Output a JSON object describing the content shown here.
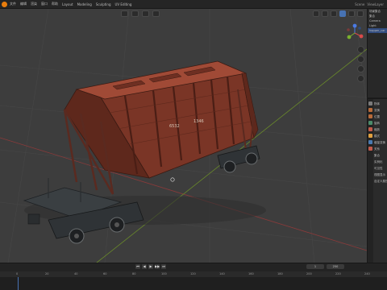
{
  "menu": {
    "items": [
      "文件",
      "编辑",
      "渲染",
      "窗口",
      "帮助",
      "Layout",
      "Modeling",
      "Sculpting",
      "UV Editing"
    ],
    "right": [
      "Scene",
      "ViewLayer"
    ]
  },
  "outliner": {
    "rows": [
      "场景集合",
      "集合",
      "Camera",
      "Light",
      "hopper_car"
    ]
  },
  "properties": {
    "rows": [
      "物体",
      "变换",
      "位置",
      "旋转",
      "缩放",
      "模式",
      "增量变换",
      "关系",
      "集合",
      "实例化",
      "可见性",
      "视图显示",
      "自定义属性"
    ]
  },
  "model": {
    "label_left": "6532",
    "label_right": "1346"
  },
  "timeline": {
    "ticks": [
      "0",
      "20",
      "40",
      "60",
      "80",
      "100",
      "120",
      "140",
      "160",
      "180",
      "200",
      "220",
      "240"
    ],
    "start_frame": "1",
    "end_frame": "250",
    "playback": [
      "⏮",
      "◀",
      "▶",
      "▶▶",
      "⏭"
    ]
  },
  "colors": {
    "accent": "#4772b3",
    "orange": "#e87d0d",
    "car_rust": "#8a3a2a"
  }
}
